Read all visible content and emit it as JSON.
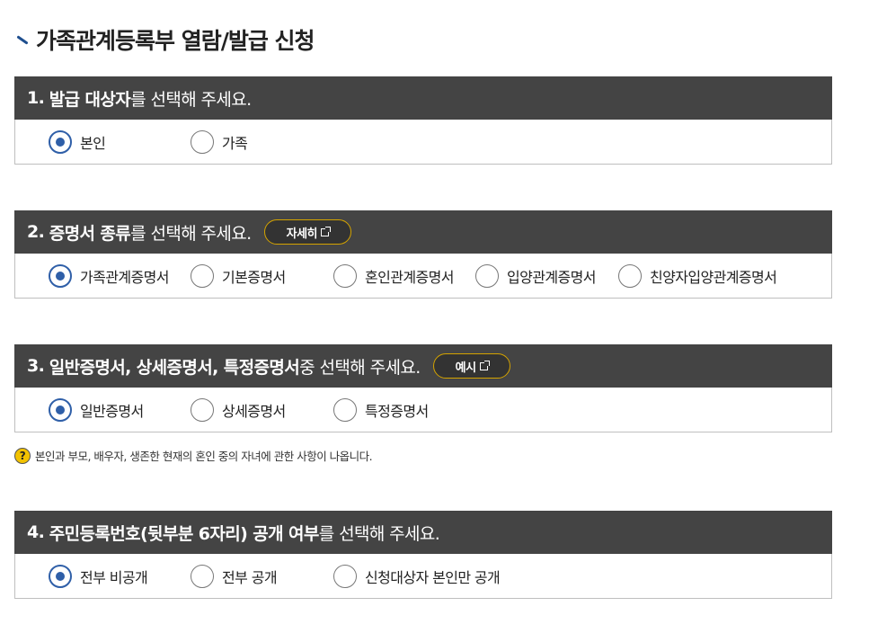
{
  "page": {
    "title": "가족관계등록부 열람/발급 신청"
  },
  "sections": [
    {
      "number": "1.",
      "bold": "발급 대상자",
      "rest": "를 선택해 주세요.",
      "button": null,
      "options": [
        {
          "label": "본인",
          "checked": true
        },
        {
          "label": "가족",
          "checked": false
        }
      ]
    },
    {
      "number": "2.",
      "bold": "증명서 종류",
      "rest": "를 선택해 주세요.",
      "button": "자세히",
      "options": [
        {
          "label": "가족관계증명서",
          "checked": true
        },
        {
          "label": "기본증명서",
          "checked": false
        },
        {
          "label": "혼인관계증명서",
          "checked": false
        },
        {
          "label": "입양관계증명서",
          "checked": false
        },
        {
          "label": "친양자입양관계증명서",
          "checked": false
        }
      ]
    },
    {
      "number": "3.",
      "bold": "일반증명서, 상세증명서, 특정증명서",
      "rest": " 중 선택해 주세요.",
      "button": "예시",
      "options": [
        {
          "label": "일반증명서",
          "checked": true
        },
        {
          "label": "상세증명서",
          "checked": false
        },
        {
          "label": "특정증명서",
          "checked": false
        }
      ]
    },
    {
      "number": "4.",
      "bold": "주민등록번호(뒷부분 6자리) 공개 여부",
      "rest": "를 선택해 주세요.",
      "button": null,
      "options": [
        {
          "label": "전부 비공개",
          "checked": true
        },
        {
          "label": "전부 공개",
          "checked": false
        },
        {
          "label": "신청대상자 본인만 공개",
          "checked": false
        }
      ]
    }
  ],
  "note": {
    "icon": "?",
    "text": "본인과 부모, 배우자, 생존한 현재의 혼인 중의 자녀에 관한 사항이 나옵니다."
  },
  "colors": {
    "header_bg": "#444444",
    "radio_accent": "#2f5fa8",
    "button_border": "#d4a300",
    "help_icon": "#f2c200"
  },
  "icons": {
    "title_mark": "slash-mark-icon",
    "external": "external-link-icon",
    "help": "question-icon"
  }
}
